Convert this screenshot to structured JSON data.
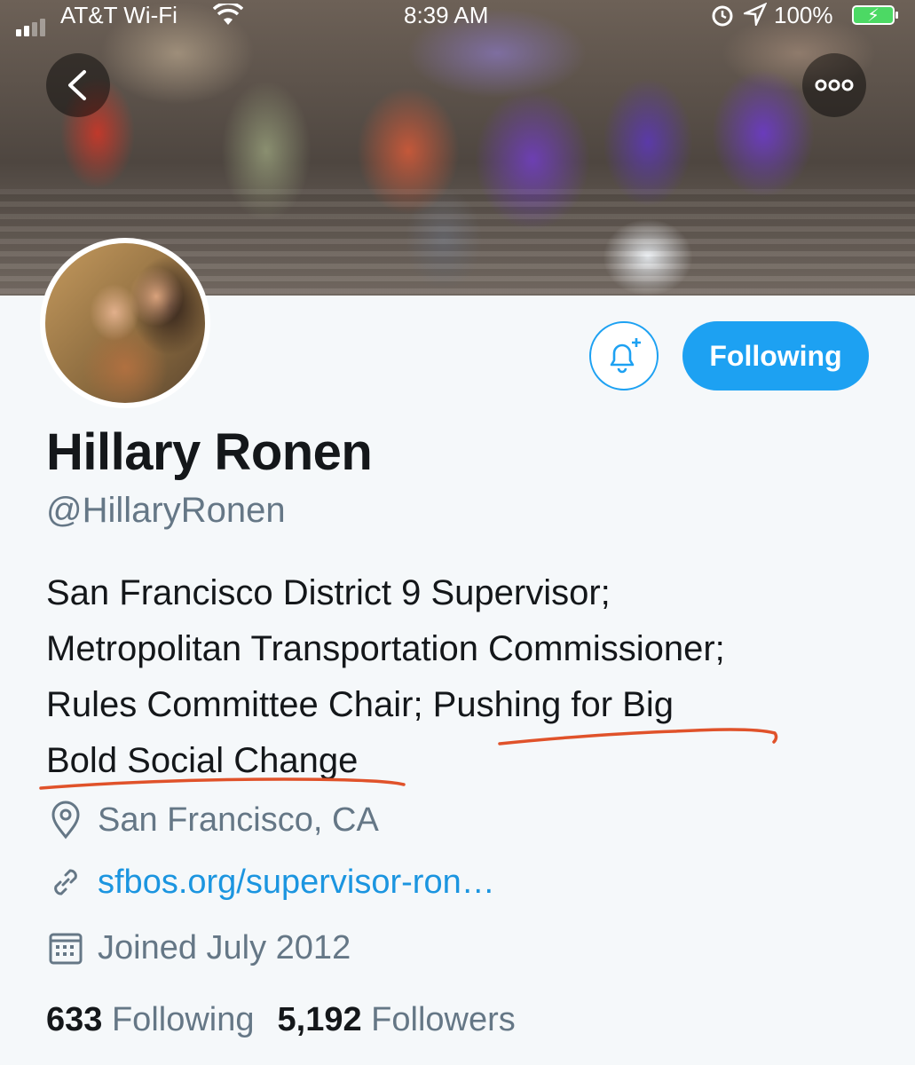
{
  "status_bar": {
    "carrier": "AT&T Wi-Fi",
    "time": "8:39 AM",
    "battery_percent": "100%"
  },
  "profile": {
    "display_name": "Hillary Ronen",
    "handle": "@HillaryRonen",
    "bio_lines": [
      "San Francisco District 9 Supervisor;",
      "Metropolitan Transportation Commissioner;",
      "Rules Committee Chair; Pushing for Big",
      "Bold Social Change"
    ],
    "location": "San Francisco, CA",
    "website": "sfbos.org/supervisor-ron…",
    "joined": "Joined July 2012"
  },
  "actions": {
    "following_label": "Following"
  },
  "stats": {
    "following_count": "633",
    "following_label": "Following",
    "followers_count": "5,192",
    "followers_label": "Followers"
  },
  "icons": {
    "back": "chevron-left-icon",
    "more": "more-horizontal-icon",
    "notify": "bell-plus-icon",
    "location": "location-pin-icon",
    "link": "link-icon",
    "calendar": "calendar-icon"
  },
  "colors": {
    "accent": "#1da1f2",
    "link": "#1b95e0",
    "secondary_text": "#657786",
    "annotation_underline": "#e0522a"
  }
}
